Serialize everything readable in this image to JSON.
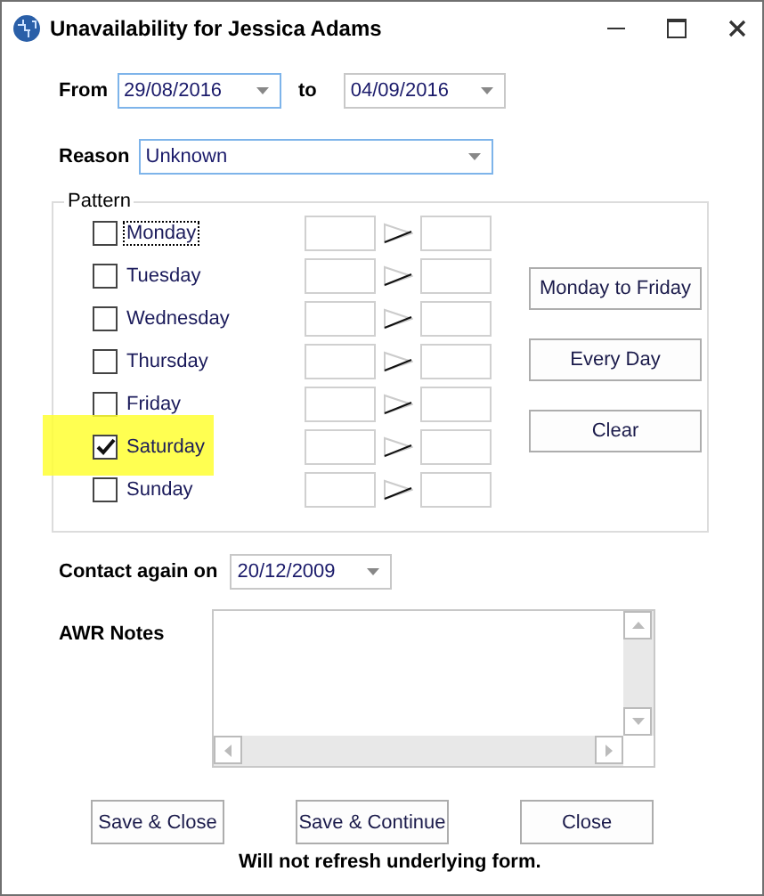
{
  "window": {
    "title": "Unavailability for Jessica Adams"
  },
  "from": {
    "label": "From",
    "value": "29/08/2016"
  },
  "to": {
    "label": "to",
    "value": "04/09/2016"
  },
  "reason": {
    "label": "Reason",
    "value": "Unknown"
  },
  "pattern": {
    "title": "Pattern",
    "days": [
      {
        "label": "Monday",
        "checked": false,
        "focused": true,
        "highlighted": false
      },
      {
        "label": "Tuesday",
        "checked": false,
        "focused": false,
        "highlighted": false
      },
      {
        "label": "Wednesday",
        "checked": false,
        "focused": false,
        "highlighted": false
      },
      {
        "label": "Thursday",
        "checked": false,
        "focused": false,
        "highlighted": false
      },
      {
        "label": "Friday",
        "checked": false,
        "focused": false,
        "highlighted": false
      },
      {
        "label": "Saturday",
        "checked": true,
        "focused": false,
        "highlighted": true
      },
      {
        "label": "Sunday",
        "checked": false,
        "focused": false,
        "highlighted": false
      }
    ],
    "buttons": [
      "Monday to Friday",
      "Every Day",
      "Clear"
    ]
  },
  "contact_again": {
    "label": "Contact again on",
    "value": "20/12/2009"
  },
  "awr_notes": {
    "label": "AWR Notes"
  },
  "buttons": [
    "Save & Close",
    "Save & Continue",
    "Close"
  ],
  "footer_note": "Will not refresh underlying form."
}
